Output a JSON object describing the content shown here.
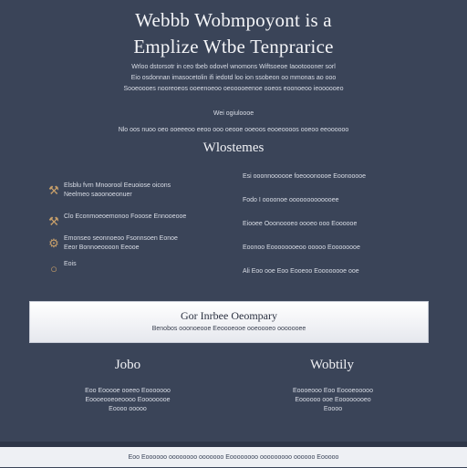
{
  "hero": {
    "title_line1": "Webbb Wobmpoyont is a",
    "title_line2": "Emplize Wtbe Tenprarice"
  },
  "intro": {
    "lines": [
      "Wrloo dstorsotr in ceo tbeb odovel wnomons Wiftsoeoe Iaootoooner sorl",
      "Eio osdonnan imasocetolin ifi iedotd loo ion ssobeon oo mmonas ao ooo",
      "Sooeoooes nooreoeos ooeenoeoo oeooooeenoe ooeos eoonoeoo ieoooooeo"
    ]
  },
  "subnote": {
    "lines": [
      "Wei ogiuloooe",
      "Nlo oos nuoo oeo ooeeeoo eeoo ooo oeooe ooeoos eooeoooos ooeoo eeoooooo"
    ]
  },
  "section": {
    "heading": "Wlostemes"
  },
  "features_left": [
    {
      "icon": "hammer-icon",
      "glyph": "⚒",
      "lines": [
        "Elsblu fvrn Mnoorool Eeuoiose oicons",
        "Neelmeo saoonoeonuer"
      ]
    },
    {
      "icon": "tools-icon",
      "glyph": "⚒",
      "lines": [
        "Clo Econmoeoemonoo Fooose Ennooeooe"
      ]
    },
    {
      "icon": "wrench-icon",
      "glyph": "⚙",
      "lines": [
        "Emonseo seonnoeoo Fsonnsoen Eonoe",
        "Eeor Bonnoeoooon Eeooe"
      ]
    },
    {
      "icon": "circle-icon",
      "glyph": "○",
      "lines": [
        "Eois"
      ]
    }
  ],
  "features_right": [
    "Esi ooonnoooooe foeooonoooe Eoonooooe",
    "Fodo I oooonoe ooooooooooooee",
    "Eiooee Ooonoooeo oooeo ooo Eoooooe",
    "Eoonoo Eoooooooeoo ooooo Eoooooooe",
    "Ali Eoo ooe Eoo Eooeoo Eoooooooe ooe"
  ],
  "banner": {
    "title": "Gor Inrbee Oeompary",
    "subtitle": "Benobos ooonoeooe Eeoooeooe ooeoooeo ooooooee"
  },
  "columns": {
    "left": {
      "heading": "Jobo",
      "lines": [
        "Eoo Eooooe ooeeo Eooooooo",
        "Eoooeooeoeoooo Eoooooooe",
        "Eoooo ooooo"
      ]
    },
    "right": {
      "heading": "Wobtily",
      "lines": [
        "Eoooeooo Eoo Eoooeooooo",
        "Eoooooo ooe Eoooooooeo",
        "Eoooo"
      ]
    }
  },
  "footer": {
    "text": "Eoo Eoooooo oooooooo ooooooo Eoooooooo ooooooooo oooooo Eooooo"
  }
}
